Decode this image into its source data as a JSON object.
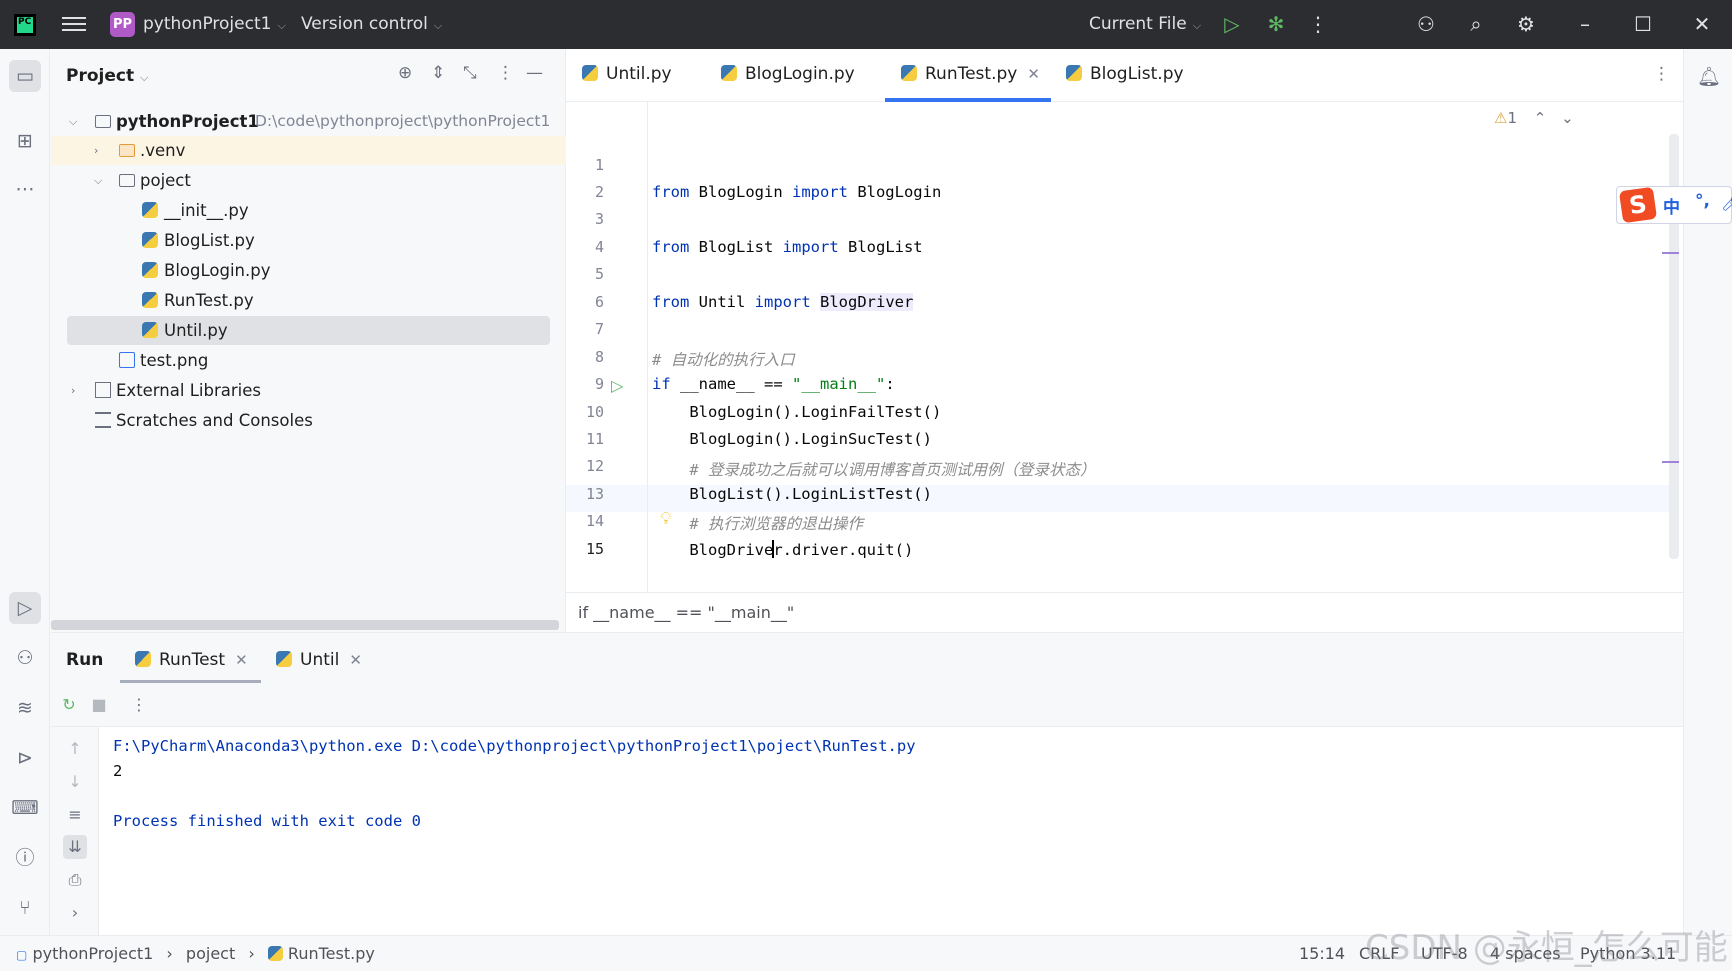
{
  "titlebar": {
    "project_badge": "PP",
    "project_name": "pythonProject1",
    "version_control": "Version control",
    "run_config": "Current File"
  },
  "project_panel": {
    "title": "Project",
    "tree": [
      {
        "label": "pythonProject1",
        "path": "D:\\code\\pythonproject\\pythonProject1"
      },
      {
        "label": ".venv"
      },
      {
        "label": "poject"
      },
      {
        "label": "__init__.py"
      },
      {
        "label": "BlogList.py"
      },
      {
        "label": "BlogLogin.py"
      },
      {
        "label": "RunTest.py"
      },
      {
        "label": "Until.py"
      },
      {
        "label": "test.png"
      },
      {
        "label": "External Libraries"
      },
      {
        "label": "Scratches and Consoles"
      }
    ]
  },
  "editor": {
    "tabs": [
      {
        "label": "Until.py"
      },
      {
        "label": "BlogLogin.py"
      },
      {
        "label": "RunTest.py",
        "active": true
      },
      {
        "label": "BlogList.py"
      }
    ],
    "warning_count": "1",
    "line_numbers": [
      "1",
      "2",
      "3",
      "4",
      "5",
      "6",
      "7",
      "8",
      "9",
      "10",
      "11",
      "12",
      "13",
      "14",
      "15"
    ],
    "lines": {
      "l2_a": "from",
      "l2_b": " BlogLogin ",
      "l2_c": "import",
      "l2_d": " BlogLogin",
      "l4_a": "from",
      "l4_b": " BlogList ",
      "l4_c": "import",
      "l4_d": " BlogList",
      "l6_a": "from",
      "l6_b": " Until ",
      "l6_c": "import",
      "l6_d": "BlogDriver",
      "l8": "# 自动化的执行入口",
      "l9_a": "if",
      "l9_b": " __name__ == ",
      "l9_c": "\"__main__\"",
      "l9_d": ":",
      "l10": "    BlogLogin().LoginFailTest()",
      "l11": "    BlogLogin().LoginSucTest()",
      "l12": "    # 登录成功之后就可以调用博客首页测试用例（登录状态）",
      "l13": "    BlogList().LoginListTest()",
      "l14": "    # 执行浏览器的退出操作",
      "l15_a": "    BlogDrive",
      "l15_b": "r.driver.quit()"
    },
    "breadcrumb": "if __name__ == \"__main__\""
  },
  "ime": {
    "char": "中",
    "punct": "°,"
  },
  "run_panel": {
    "title": "Run",
    "tabs": [
      {
        "label": "RunTest"
      },
      {
        "label": "Until"
      }
    ],
    "console": [
      "F:\\PyCharm\\Anaconda3\\python.exe D:\\code\\pythonproject\\pythonProject1\\poject\\RunTest.py",
      "2",
      "",
      "Process finished with exit code 0"
    ]
  },
  "statusbar": {
    "crumbs": [
      "pythonProject1",
      "poject",
      "RunTest.py"
    ],
    "position": "15:14",
    "line_sep": "CRLF",
    "encoding": "UTF-8",
    "indent": "4 spaces",
    "interpreter": "Python 3.11"
  },
  "watermark": "CSDN @永恒_怎么可能"
}
